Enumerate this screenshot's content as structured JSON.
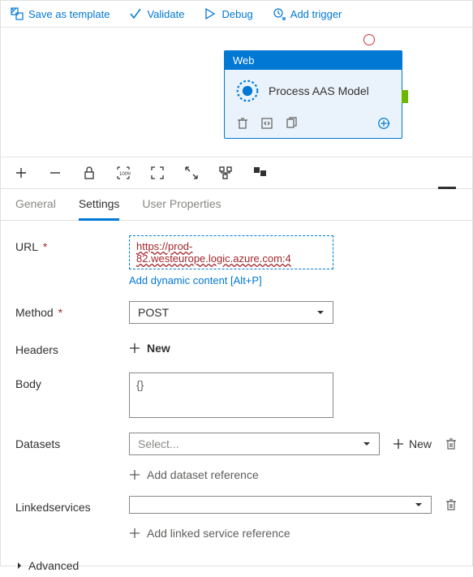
{
  "toolbar": {
    "save_template": "Save as template",
    "validate": "Validate",
    "debug": "Debug",
    "add_trigger": "Add trigger"
  },
  "activity": {
    "type_label": "Web",
    "title": "Process AAS Model"
  },
  "tabs": {
    "general": "General",
    "settings": "Settings",
    "user_properties": "User Properties"
  },
  "form": {
    "url_label": "URL",
    "url_value": "https://prod-82.westeurope.logic.azure.com:4",
    "add_dynamic": "Add dynamic content [Alt+P]",
    "method_label": "Method",
    "method_value": "POST",
    "headers_label": "Headers",
    "new_label": "New",
    "body_label": "Body",
    "body_value": "{}",
    "datasets_label": "Datasets",
    "select_placeholder": "Select...",
    "add_dataset_ref": "Add dataset reference",
    "linked_label": "Linkedservices",
    "add_linked_ref": "Add linked service reference",
    "advanced": "Advanced"
  }
}
